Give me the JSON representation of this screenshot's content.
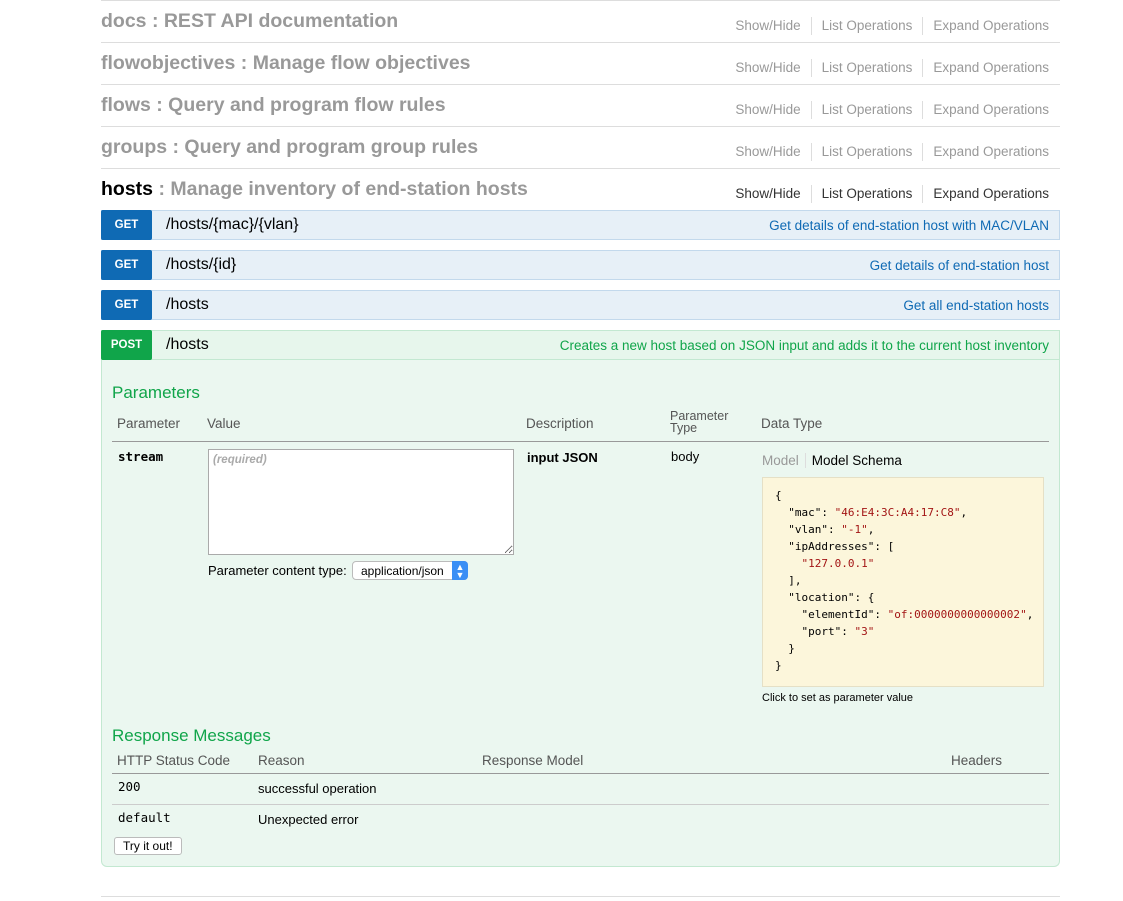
{
  "resources": [
    {
      "name": "docs",
      "description": ": REST API documentation",
      "active": false
    },
    {
      "name": "flowobjectives",
      "description": ": Manage flow objectives",
      "active": false
    },
    {
      "name": "flows",
      "description": ": Query and program flow rules",
      "active": false
    },
    {
      "name": "groups",
      "description": ": Query and program group rules",
      "active": false
    },
    {
      "name": "hosts",
      "description": ": Manage inventory of end-station hosts",
      "active": true
    }
  ],
  "resource_ops": {
    "show_hide": "Show/Hide",
    "list": "List Operations",
    "expand": "Expand Operations"
  },
  "endpoints": [
    {
      "method": "GET",
      "path": "/hosts/{mac}/{vlan}",
      "summary": "Get details of end-station host with MAC/VLAN"
    },
    {
      "method": "GET",
      "path": "/hosts/{id}",
      "summary": "Get details of end-station host"
    },
    {
      "method": "GET",
      "path": "/hosts",
      "summary": "Get all end-station hosts"
    },
    {
      "method": "POST",
      "path": "/hosts",
      "summary": "Creates a new host based on JSON input and adds it to the current host inventory"
    }
  ],
  "parameters": {
    "title": "Parameters",
    "headers": {
      "parameter": "Parameter",
      "value": "Value",
      "description": "Description",
      "param_type_1": "Parameter",
      "param_type_2": "Type",
      "data_type": "Data Type"
    },
    "row": {
      "name": "stream",
      "placeholder": "(required)",
      "description": "input JSON",
      "param_type": "body",
      "content_type_label": "Parameter content type:",
      "content_type_value": "application/json",
      "model_tab": "Model",
      "model_schema_tab": "Model Schema",
      "schema": {
        "mac": "46:E4:3C:A4:17:C8",
        "vlan": "-1",
        "ipAddress": "127.0.0.1",
        "elementId": "of:0000000000000002",
        "port": "3"
      },
      "click_hint": "Click to set as parameter value"
    }
  },
  "responses": {
    "title": "Response Messages",
    "headers": {
      "code": "HTTP Status Code",
      "reason": "Reason",
      "model": "Response Model",
      "headers": "Headers"
    },
    "rows": [
      {
        "code": "200",
        "reason": "successful operation"
      },
      {
        "code": "default",
        "reason": "Unexpected error"
      }
    ]
  },
  "try_button": "Try it out!",
  "colors": {
    "get": "#0f6ab4",
    "post": "#10a54a",
    "schema_bg": "#fcf6db"
  }
}
